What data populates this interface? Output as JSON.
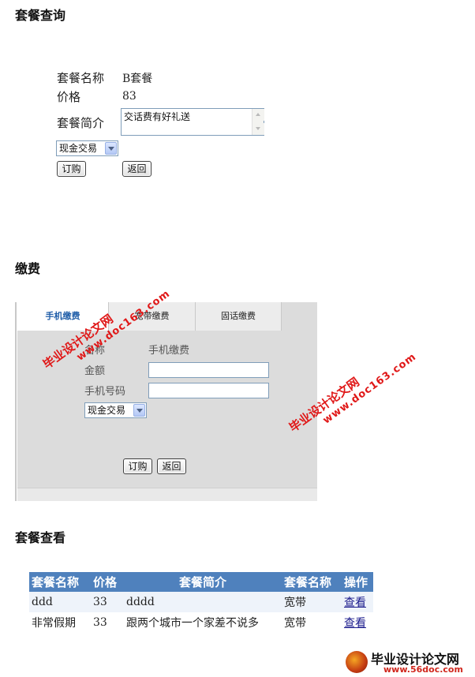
{
  "query_section": {
    "heading": "套餐查询",
    "name_label": "套餐名称",
    "name_value": "B套餐",
    "price_label": "价格",
    "price_value": "83",
    "intro_label": "套餐简介",
    "intro_value": "交话费有好礼送",
    "payment_select": "现金交易",
    "order_button": "订购",
    "back_button": "返回"
  },
  "payment_section": {
    "heading": "缴费",
    "tabs": [
      "手机缴费",
      "宽带缴费",
      "固话缴费"
    ],
    "active_tab": 0,
    "name_label": "名称",
    "name_value": "手机缴费",
    "amount_label": "金额",
    "amount_value": "",
    "phone_label": "手机号码",
    "phone_value": "",
    "payment_select": "现金交易",
    "order_button": "订购",
    "back_button": "返回"
  },
  "view_section": {
    "heading": "套餐查看",
    "columns": [
      "套餐名称",
      "价格",
      "套餐简介",
      "套餐名称",
      "操作"
    ],
    "rows": [
      {
        "name": "ddd",
        "price": "33",
        "intro": "dddd",
        "type": "宽带",
        "action": "查看"
      },
      {
        "name": "非常假期",
        "price": "33",
        "intro": "跟两个城市一个家差不说多",
        "type": "宽带",
        "action": "查看"
      }
    ]
  },
  "watermarks": {
    "cn": "毕业设计论文网",
    "url": "www.doc163.com"
  },
  "logo": {
    "cn": "毕业设计论文网",
    "url": "www.56doc.com"
  }
}
